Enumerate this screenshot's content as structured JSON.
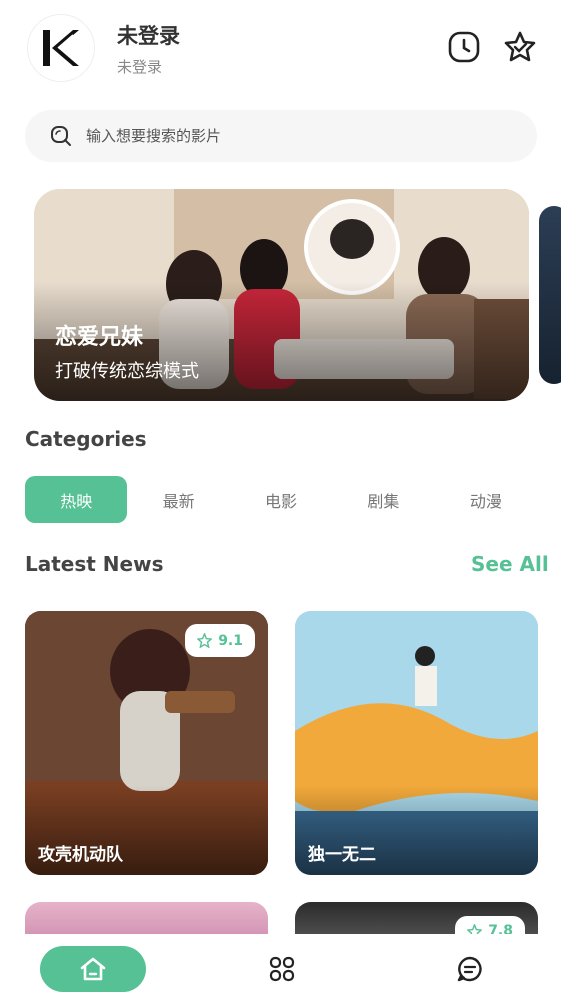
{
  "header": {
    "logo_letter": "K",
    "user_name": "未登录",
    "user_status": "未登录",
    "icons": [
      "history-icon",
      "favorite-star-icon"
    ]
  },
  "search": {
    "placeholder": "输入想要搜索的影片",
    "icon": "search-icon"
  },
  "banner": {
    "title": "恋爱兄妹",
    "subtitle": "打破传统恋综模式"
  },
  "categories": {
    "title": "Categories",
    "tabs": [
      "热映",
      "最新",
      "电影",
      "剧集",
      "动漫"
    ],
    "active_index": 0
  },
  "latest_news": {
    "title": "Latest News",
    "see_all": "See All",
    "cards": [
      {
        "title": "攻壳机动队",
        "rating": "9.1"
      },
      {
        "title": "独一无二",
        "rating": ""
      },
      {
        "title": "",
        "rating": ""
      },
      {
        "title": "",
        "rating": "7.8"
      }
    ]
  },
  "bottom_nav": {
    "items": [
      "home-icon",
      "grid-icon",
      "chat-icon"
    ],
    "active_index": 0
  },
  "colors": {
    "accent": "#55c195",
    "text_dark": "#333333",
    "text_muted": "#777777",
    "search_bg": "#f6f6f6"
  }
}
